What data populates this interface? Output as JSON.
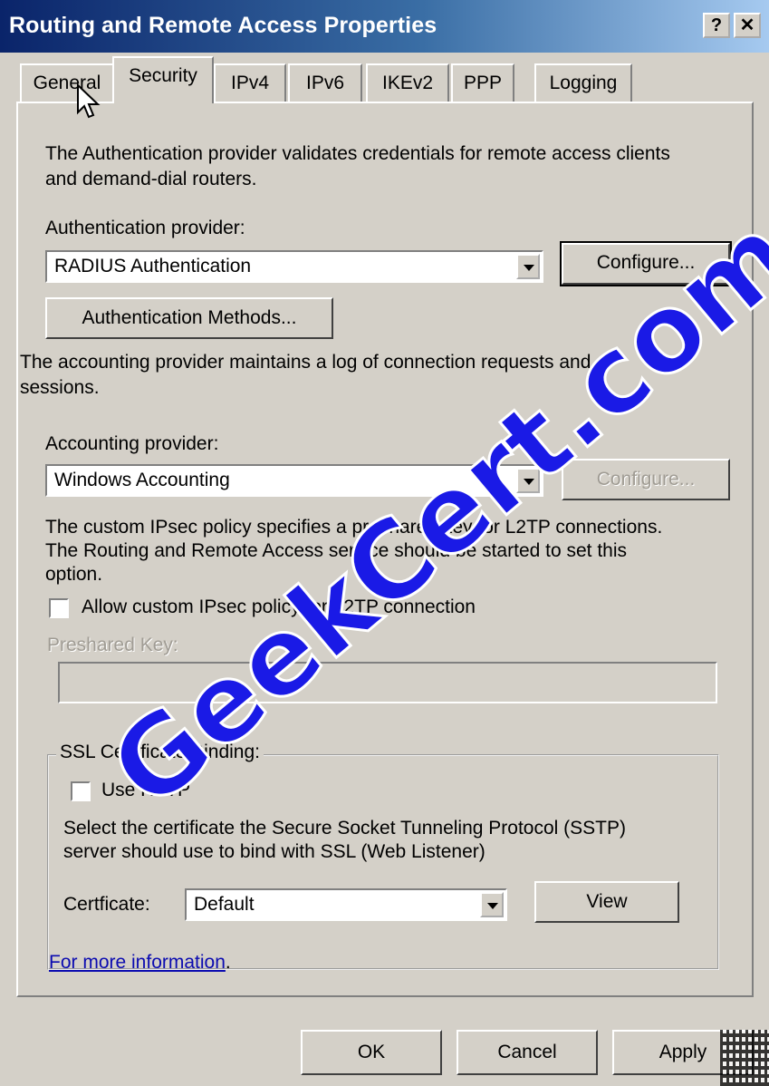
{
  "window": {
    "title": "Routing and Remote Access Properties",
    "help_glyph": "?",
    "close_glyph": "✕"
  },
  "tabs": [
    {
      "label": "General"
    },
    {
      "label": "Security",
      "active": true
    },
    {
      "label": "IPv4"
    },
    {
      "label": "IPv6"
    },
    {
      "label": "IKEv2"
    },
    {
      "label": "PPP"
    },
    {
      "label": "Logging"
    }
  ],
  "security": {
    "intro_line1": "The Authentication provider validates credentials for remote access clients",
    "intro_line2": "and demand-dial routers.",
    "auth_provider_label": "Authentication provider:",
    "auth_provider_value": "RADIUS Authentication",
    "auth_configure_label": "Configure...",
    "auth_methods_label": "Authentication Methods...",
    "accounting_desc_line1": "The accounting provider maintains a log of connection requests and",
    "accounting_desc_line2": "sessions.",
    "accounting_provider_label": "Accounting provider:",
    "accounting_provider_value": "Windows Accounting",
    "accounting_configure_label": "Configure...",
    "ipsec_desc_line1": "The custom IPsec policy specifies a preshared key for L2TP connections.",
    "ipsec_desc_line2": "The Routing and Remote Access service should be started to set this",
    "ipsec_desc_line3": "option.",
    "ipsec_checkbox_label": "Allow custom IPsec policy for L2TP connection",
    "ipsec_checked": false,
    "preshared_key_label": "Preshared Key:",
    "preshared_key_value": ""
  },
  "sstp": {
    "group_label": "SSL Certificate Binding:",
    "use_http_label": "Use HTTP",
    "use_http_checked": false,
    "desc_line1": "Select the certificate the Secure Socket Tunneling Protocol (SSTP)",
    "desc_line2": "server should use to bind with SSL (Web Listener)",
    "certificate_label": "Certficate:",
    "certificate_value": "Default",
    "view_label": "View"
  },
  "more_info_link": "For more information",
  "more_info_suffix": ".",
  "footer": {
    "ok_label": "OK",
    "cancel_label": "Cancel",
    "apply_label": "Apply"
  },
  "watermark": "GeekCert.com"
}
